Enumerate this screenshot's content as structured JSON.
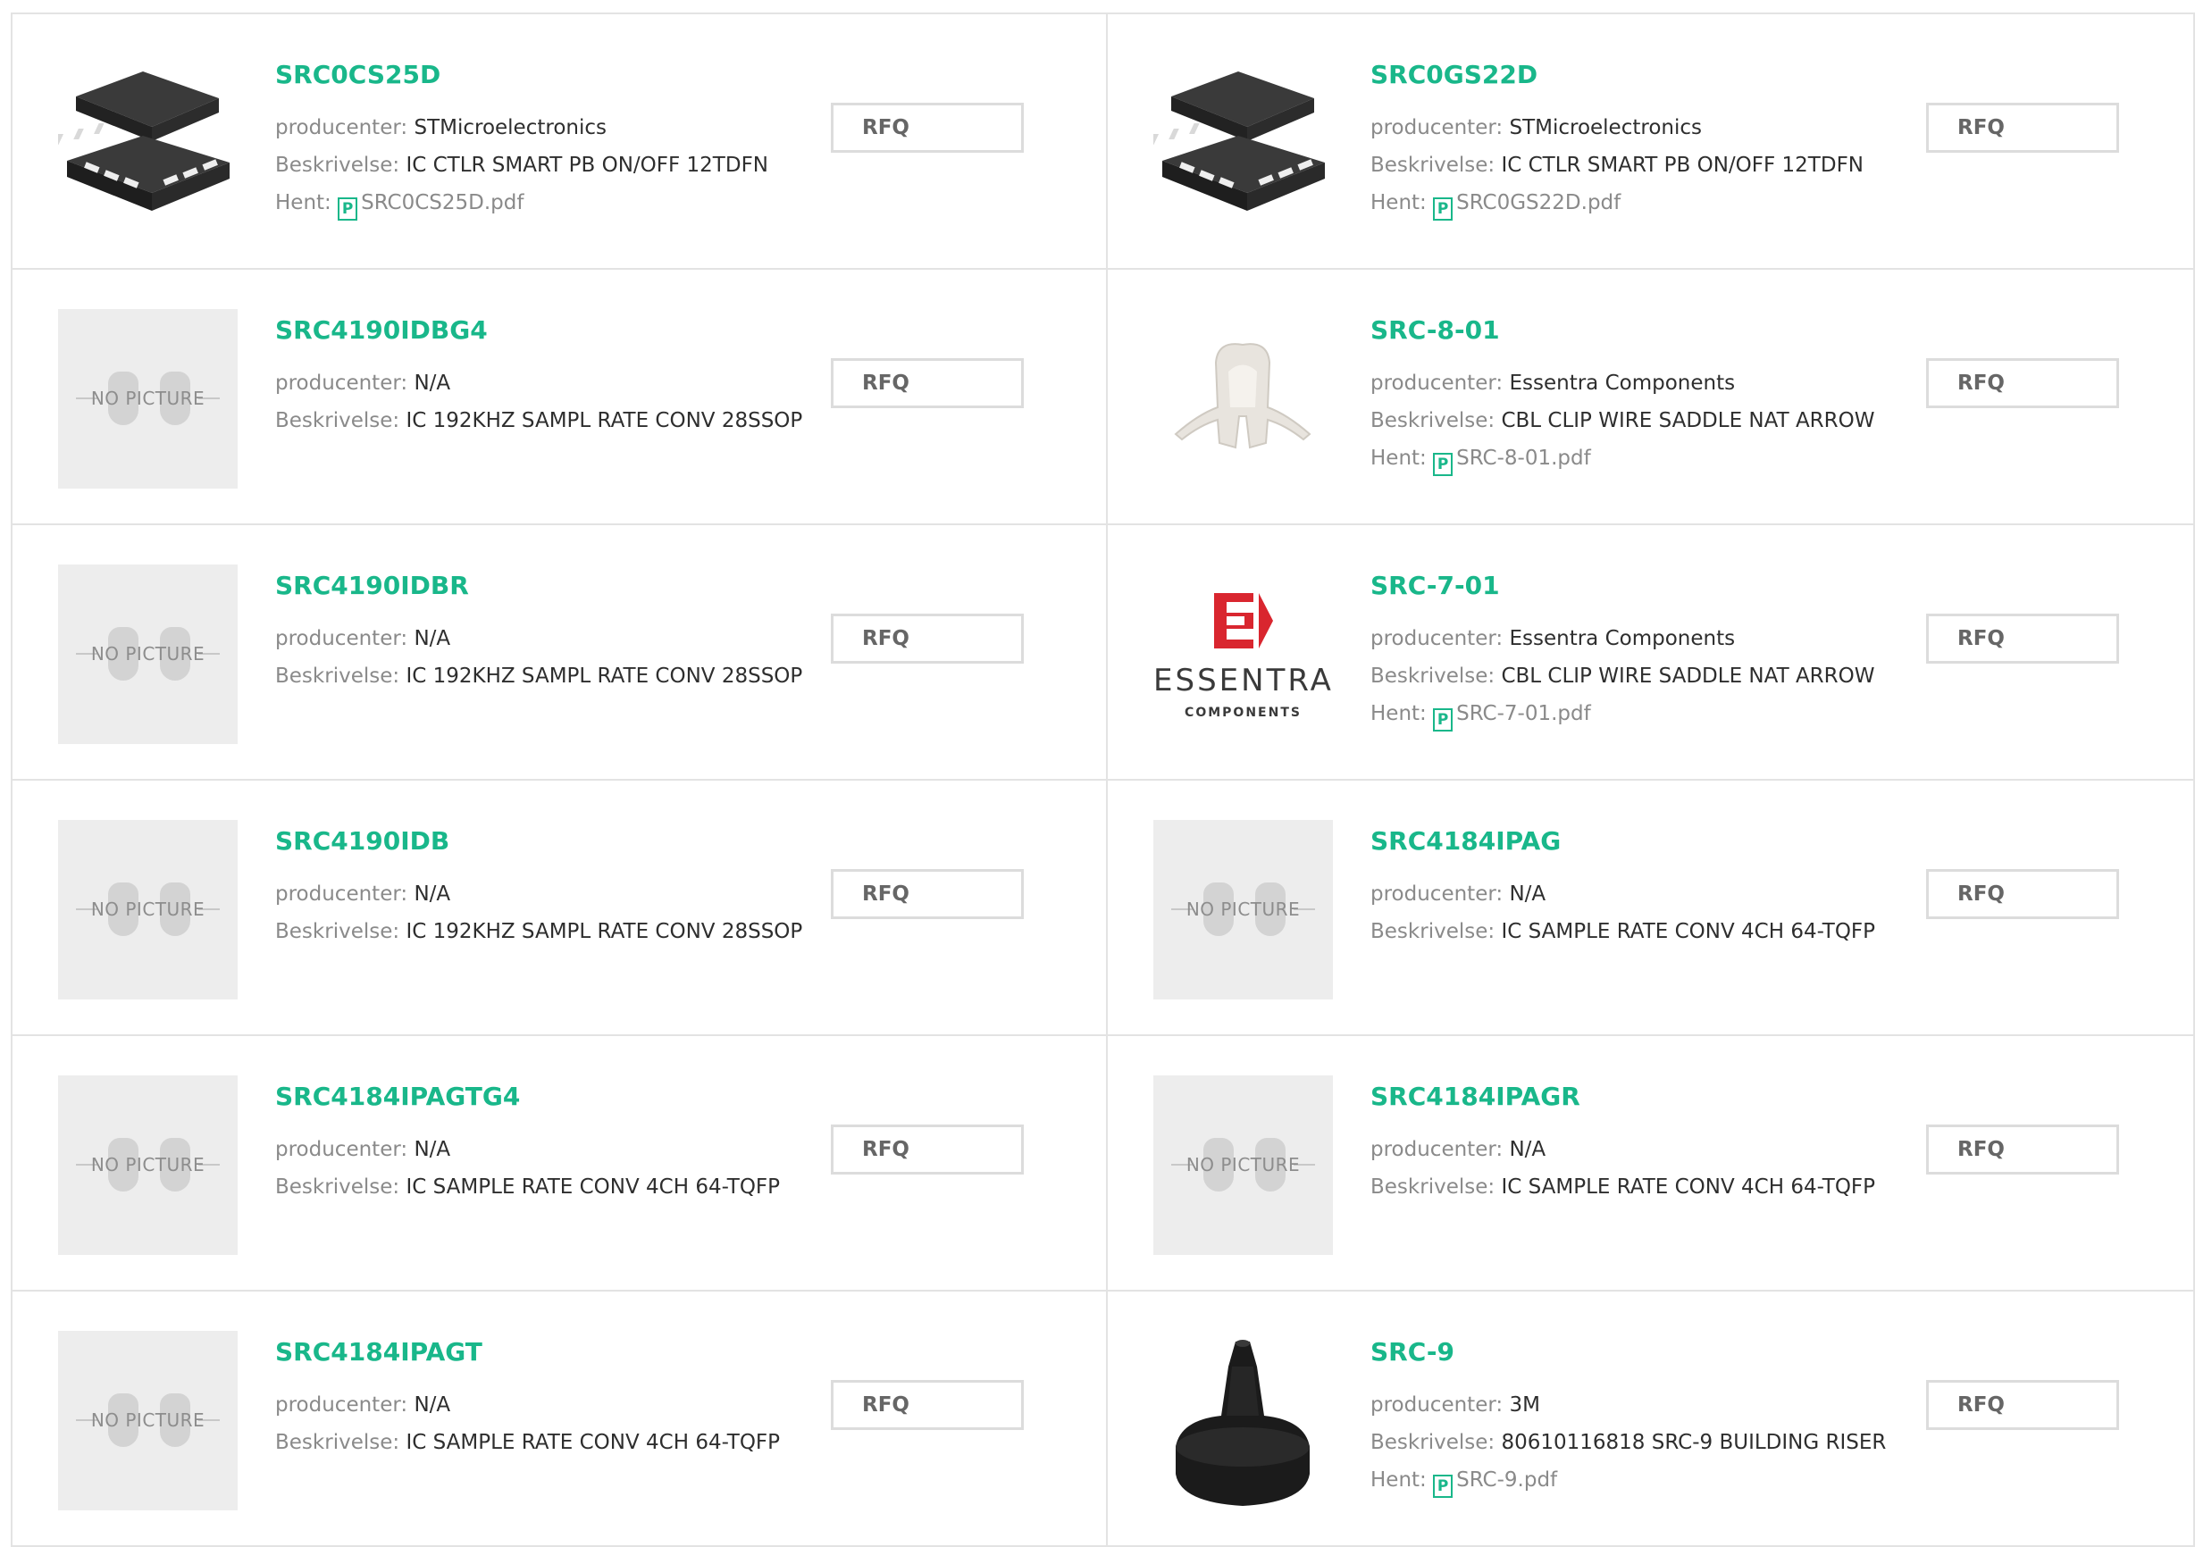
{
  "labels": {
    "manufacturer": "producenter:",
    "description": "Beskrivelse:",
    "download": "Hent:",
    "rfq": "RFQ",
    "no_picture": "NO PICTURE"
  },
  "products": [
    {
      "pn": "SRC0CS25D",
      "manufacturer": "STMicroelectronics",
      "description": "IC CTLR SMART PB ON/OFF 12TDFN",
      "pdf": "SRC0CS25D.pdf",
      "image": "ic-package-photo"
    },
    {
      "pn": "SRC0GS22D",
      "manufacturer": "STMicroelectronics",
      "description": "IC CTLR SMART PB ON/OFF 12TDFN",
      "pdf": "SRC0GS22D.pdf",
      "image": "ic-package-photo"
    },
    {
      "pn": "SRC4190IDBG4",
      "manufacturer": "N/A",
      "description": "IC 192KHZ SAMPL RATE CONV 28SSOP",
      "pdf": null,
      "image": "no-picture"
    },
    {
      "pn": "SRC-8-01",
      "manufacturer": "Essentra Components",
      "description": "CBL CLIP WIRE SADDLE NAT ARROW",
      "pdf": "SRC-8-01.pdf",
      "image": "wire-clip-photo"
    },
    {
      "pn": "SRC4190IDBR",
      "manufacturer": "N/A",
      "description": "IC 192KHZ SAMPL RATE CONV 28SSOP",
      "pdf": null,
      "image": "no-picture"
    },
    {
      "pn": "SRC-7-01",
      "manufacturer": "Essentra Components",
      "description": "CBL CLIP WIRE SADDLE NAT ARROW",
      "pdf": "SRC-7-01.pdf",
      "image": "essentra-logo",
      "logo_text": "ESSENTRA",
      "logo_sub": "COMPONENTS"
    },
    {
      "pn": "SRC4190IDB",
      "manufacturer": "N/A",
      "description": "IC 192KHZ SAMPL RATE CONV 28SSOP",
      "pdf": null,
      "image": "no-picture"
    },
    {
      "pn": "SRC4184IPAG",
      "manufacturer": "N/A",
      "description": "IC SAMPLE RATE CONV 4CH 64-TQFP",
      "pdf": null,
      "image": "no-picture"
    },
    {
      "pn": "SRC4184IPAGTG4",
      "manufacturer": "N/A",
      "description": "IC SAMPLE RATE CONV 4CH 64-TQFP",
      "pdf": null,
      "image": "no-picture"
    },
    {
      "pn": "SRC4184IPAGR",
      "manufacturer": "N/A",
      "description": "IC SAMPLE RATE CONV 4CH 64-TQFP",
      "pdf": null,
      "image": "no-picture"
    },
    {
      "pn": "SRC4184IPAGT",
      "manufacturer": "N/A",
      "description": "IC SAMPLE RATE CONV 4CH 64-TQFP",
      "pdf": null,
      "image": "no-picture"
    },
    {
      "pn": "SRC-9",
      "manufacturer": "3M",
      "description": "80610116818 SRC-9 BUILDING RISER",
      "pdf": "SRC-9.pdf",
      "image": "riser-photo"
    }
  ],
  "colors": {
    "accent": "#19b78a",
    "border": "#e3e3e3",
    "nopic_bg": "#ededed",
    "logo_red": "#d9262f"
  }
}
